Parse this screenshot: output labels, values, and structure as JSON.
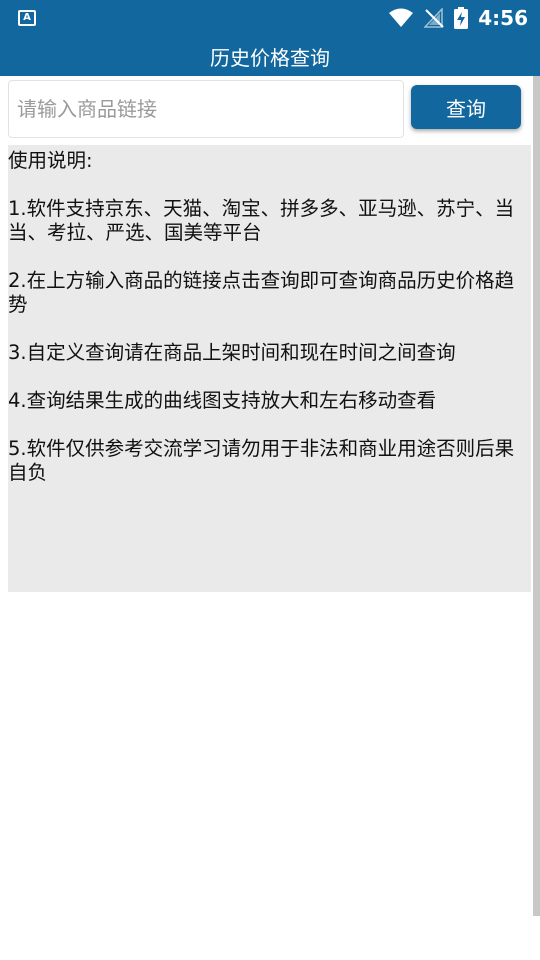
{
  "status_bar": {
    "left_icon": "A",
    "time": "4:56",
    "icons": [
      "wifi-icon",
      "signal-off-icon",
      "battery-charging-icon"
    ]
  },
  "app_bar": {
    "title": "历史价格查询"
  },
  "search": {
    "placeholder": "请输入商品链接",
    "value": "",
    "button_label": "查询"
  },
  "instructions": {
    "heading": "使用说明:",
    "items": [
      "  1.软件支持京东、天猫、淘宝、拼多多、亚马逊、苏宁、当当、考拉、严选、国美等平台",
      "  2.在上方输入商品的链接点击查询即可查询商品历史价格趋势",
      "  3.自定义查询请在商品上架时间和现在时间之间查询",
      "  4.查询结果生成的曲线图支持放大和左右移动查看",
      "  5.软件仅供参考交流学习请勿用于非法和商业用途否则后果自负"
    ]
  },
  "colors": {
    "primary": "#12679e",
    "panel_bg": "#eaeaea"
  }
}
